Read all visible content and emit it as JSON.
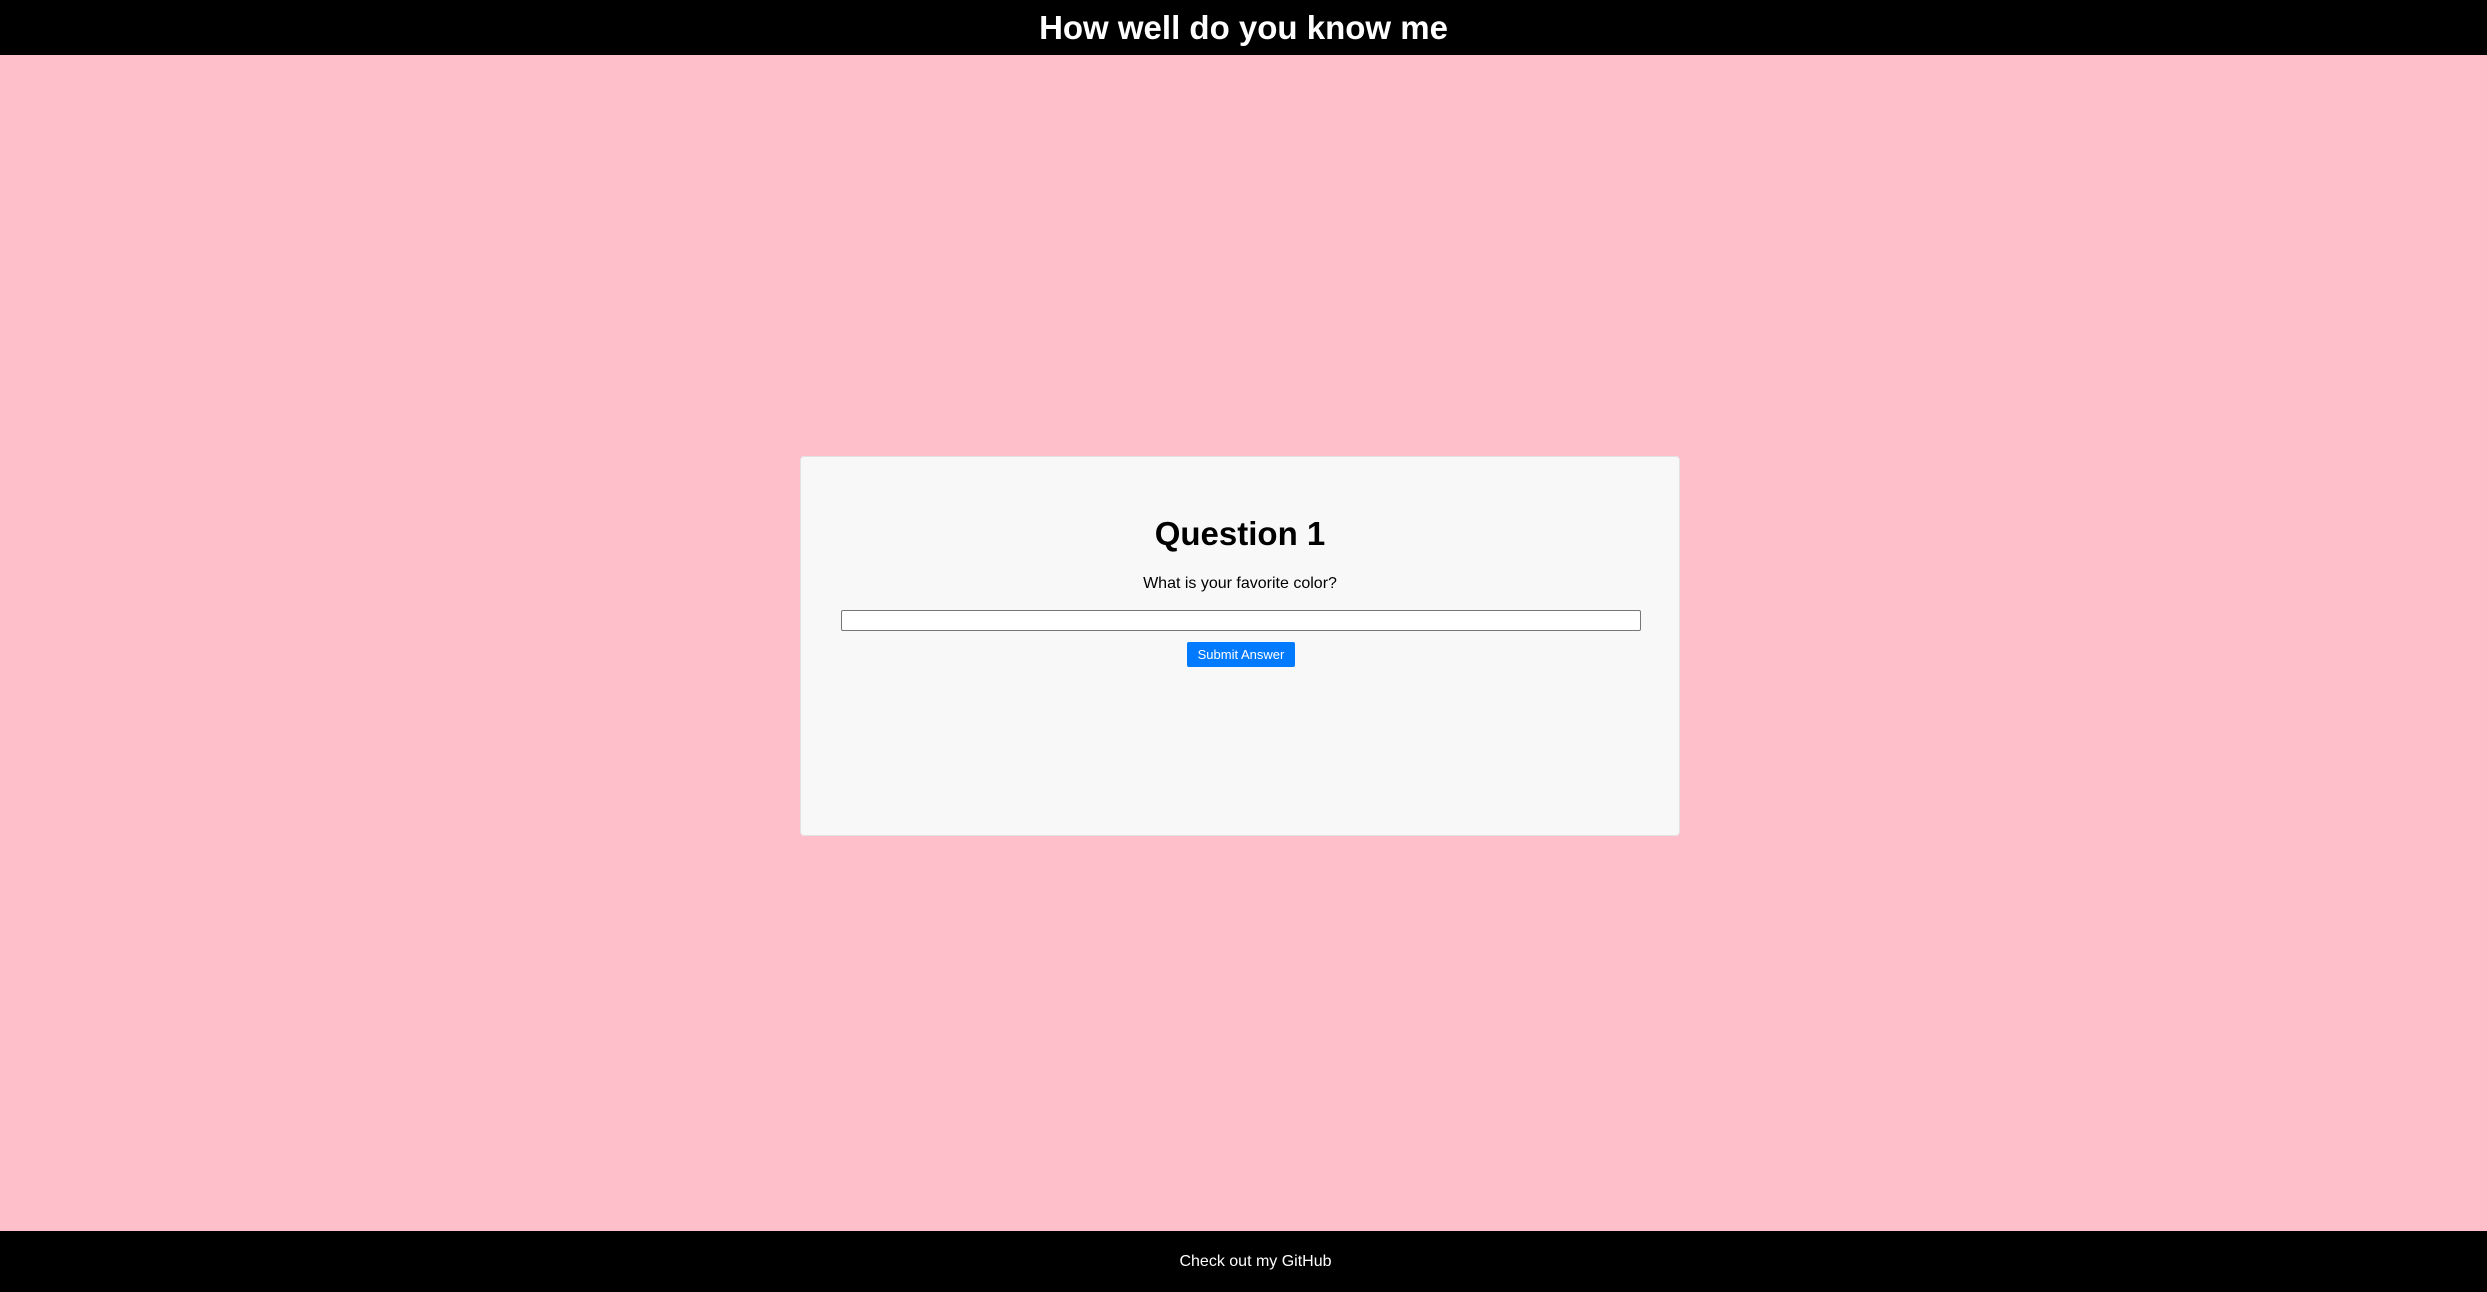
{
  "header": {
    "title": "How well do you know me"
  },
  "quiz": {
    "question_title": "Question 1",
    "question_text": "What is your favorite color?",
    "answer_value": "",
    "answer_placeholder": "",
    "submit_label": "Submit Answer"
  },
  "footer": {
    "link_text": "Check out my GitHub"
  },
  "colors": {
    "background": "#ffbfca",
    "bars": "#000000",
    "card": "#f8f8f8",
    "accent": "#007bff"
  }
}
